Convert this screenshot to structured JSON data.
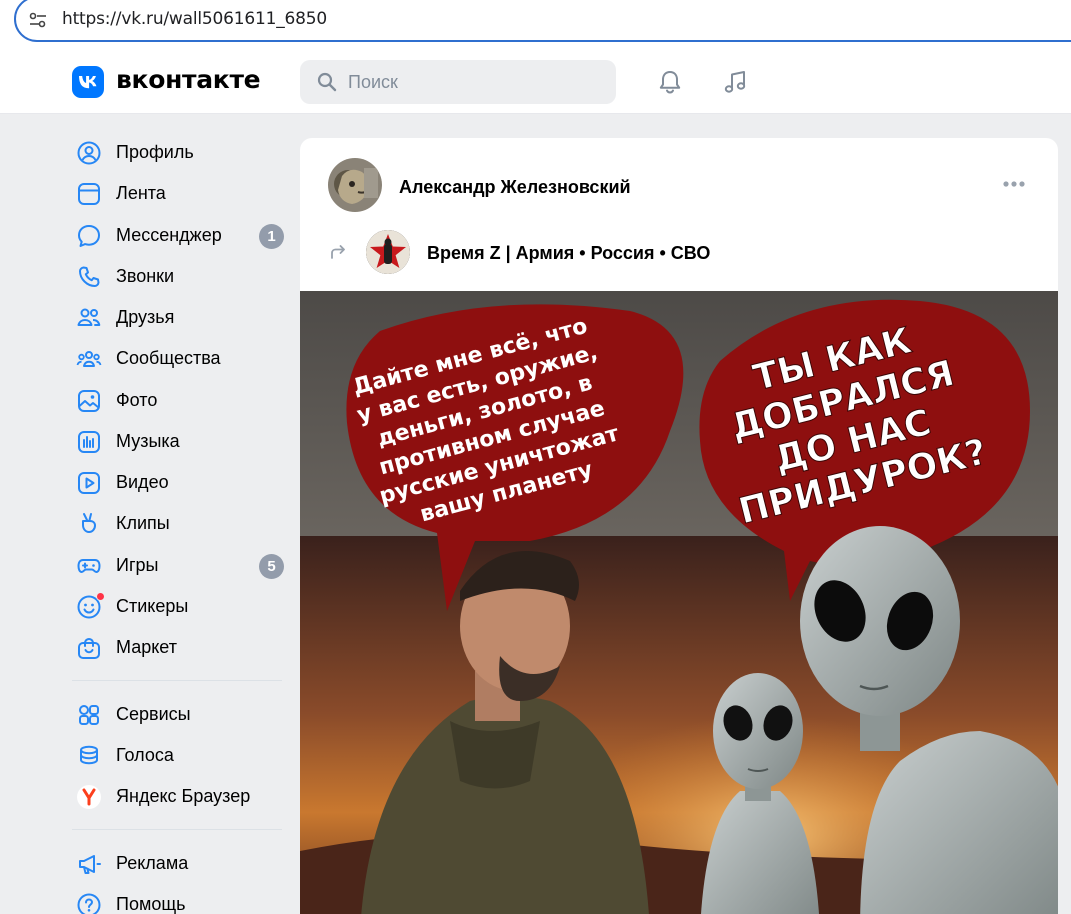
{
  "browser": {
    "url": "https://vk.ru/wall5061611_6850"
  },
  "header": {
    "logo_text": "вконтакте",
    "search_placeholder": "Поиск"
  },
  "sidebar": {
    "items": [
      {
        "label": "Профиль",
        "icon": "profile-icon"
      },
      {
        "label": "Лента",
        "icon": "feed-icon"
      },
      {
        "label": "Мессенджер",
        "icon": "messenger-icon",
        "badge": "1"
      },
      {
        "label": "Звонки",
        "icon": "phone-icon"
      },
      {
        "label": "Друзья",
        "icon": "friends-icon"
      },
      {
        "label": "Сообщества",
        "icon": "communities-icon"
      },
      {
        "label": "Фото",
        "icon": "photo-icon"
      },
      {
        "label": "Музыка",
        "icon": "music-icon"
      },
      {
        "label": "Видео",
        "icon": "video-icon"
      },
      {
        "label": "Клипы",
        "icon": "clips-icon"
      },
      {
        "label": "Игры",
        "icon": "games-icon",
        "badge": "5"
      },
      {
        "label": "Стикеры",
        "icon": "stickers-icon"
      },
      {
        "label": "Маркет",
        "icon": "market-icon"
      }
    ],
    "extra_items": [
      {
        "label": "Сервисы",
        "icon": "services-icon"
      },
      {
        "label": "Голоса",
        "icon": "votes-icon"
      },
      {
        "label": "Яндекс Браузер",
        "icon": "yandex-browser-icon"
      }
    ],
    "bottom_items": [
      {
        "label": "Реклама",
        "icon": "ads-icon"
      },
      {
        "label": "Помощь",
        "icon": "help-icon"
      }
    ]
  },
  "post": {
    "author_name": "Александр Железновский",
    "source_name": "Время Z | Армия • Россия • СВО",
    "image": {
      "bubble_left_lines": [
        "Дайте мне всё, что",
        "у вас есть, оружие,",
        "деньги, золото, в",
        "противном случае",
        "русские уничтожат",
        "вашу планету"
      ],
      "bubble_right_lines": [
        "ТЫ КАК",
        "ДОБРАЛСЯ",
        "ДО НАС",
        "ПРИДУРОК?"
      ]
    }
  },
  "colors": {
    "vk_blue": "#0077ff",
    "badge_gray": "#939cab",
    "nav_icon_blue": "#2787f5",
    "bubble_red": "#8e0f0f"
  }
}
